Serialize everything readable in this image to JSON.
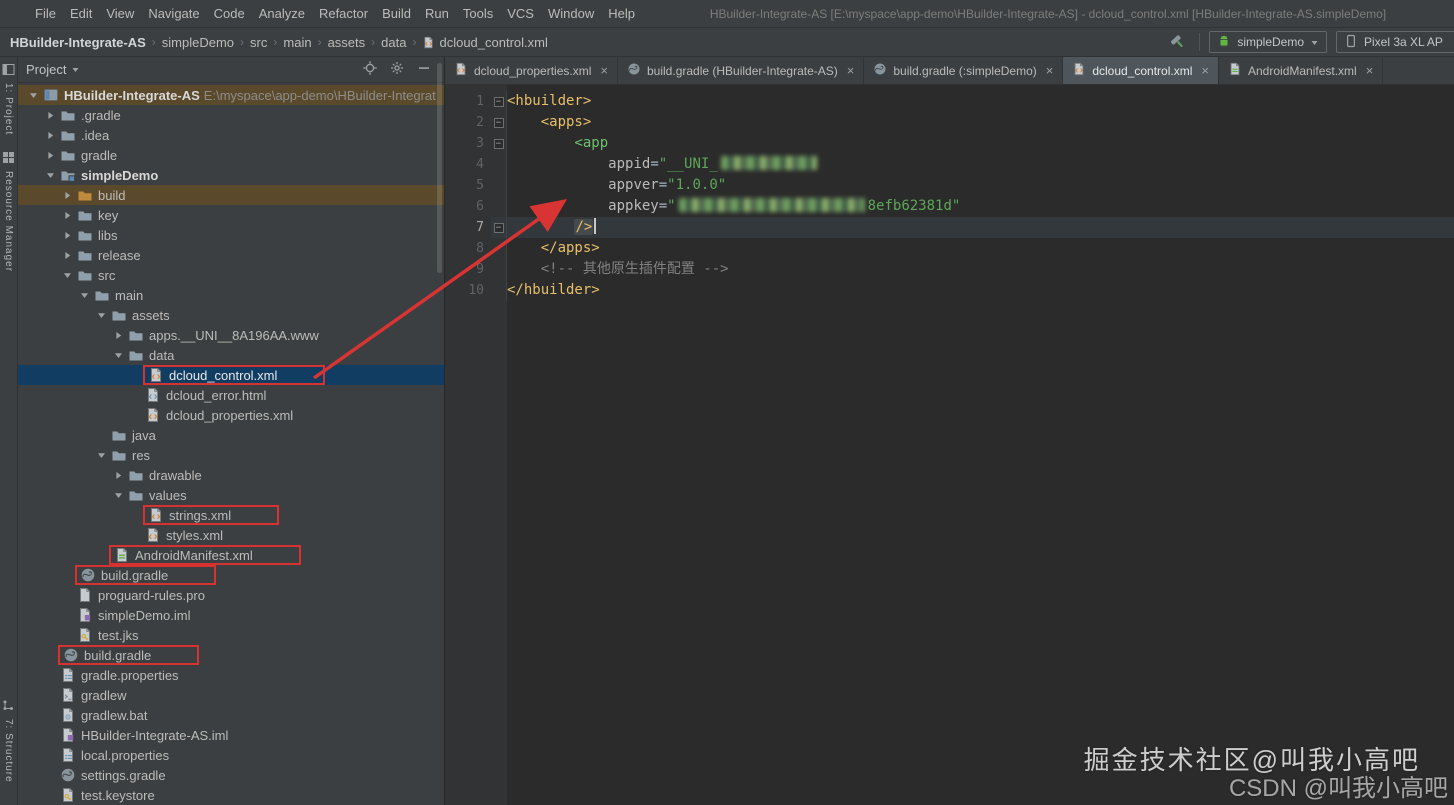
{
  "window": {
    "title": "HBuilder-Integrate-AS [E:\\myspace\\app-demo\\HBuilder-Integrate-AS] - dcloud_control.xml [HBuilder-Integrate-AS.simpleDemo]"
  },
  "menu": {
    "items": [
      "File",
      "Edit",
      "View",
      "Navigate",
      "Code",
      "Analyze",
      "Refactor",
      "Build",
      "Run",
      "Tools",
      "VCS",
      "Window",
      "Help"
    ]
  },
  "breadcrumb_bar": {
    "path": [
      "HBuilder-Integrate-AS",
      "simpleDemo",
      "src",
      "main",
      "assets",
      "data",
      "dcloud_control.xml"
    ]
  },
  "run_toolbar": {
    "config_label": "simpleDemo",
    "device_label": "Pixel 3a XL AP"
  },
  "left_stripe": {
    "top": [
      {
        "icon": "project-tool-icon",
        "label": "1: Project"
      },
      {
        "icon": "resource-manager-icon",
        "label": "Resource Manager"
      }
    ],
    "bottom": [
      {
        "icon": "structure-icon",
        "label": "7: Structure"
      }
    ]
  },
  "project_panel": {
    "title": "Project",
    "tree": [
      {
        "d": 0,
        "chevron": "open",
        "icon": "project",
        "label": "HBuilder-Integrate-AS",
        "extra": "E:\\myspace\\app-demo\\HBuilder-Integrat",
        "bold": true,
        "highlight": "brown"
      },
      {
        "d": 1,
        "chevron": "closed",
        "icon": "folder",
        "label": ".gradle"
      },
      {
        "d": 1,
        "chevron": "closed",
        "icon": "folder",
        "label": ".idea"
      },
      {
        "d": 1,
        "chevron": "closed",
        "icon": "folder",
        "label": "gradle"
      },
      {
        "d": 1,
        "chevron": "open",
        "icon": "module",
        "label": "simpleDemo",
        "bold": true
      },
      {
        "d": 2,
        "chevron": "closed",
        "icon": "folder-build",
        "label": "build",
        "highlight": "brown"
      },
      {
        "d": 2,
        "chevron": "closed",
        "icon": "folder",
        "label": "key"
      },
      {
        "d": 2,
        "chevron": "closed",
        "icon": "folder",
        "label": "libs"
      },
      {
        "d": 2,
        "chevron": "closed",
        "icon": "folder",
        "label": "release"
      },
      {
        "d": 2,
        "chevron": "open",
        "icon": "folder",
        "label": "src"
      },
      {
        "d": 3,
        "chevron": "open",
        "icon": "folder",
        "label": "main"
      },
      {
        "d": 4,
        "chevron": "open",
        "icon": "folder",
        "label": "assets"
      },
      {
        "d": 5,
        "chevron": "closed",
        "icon": "folder",
        "label": "apps.__UNI__8A196AA.www"
      },
      {
        "d": 5,
        "chevron": "open",
        "icon": "folder",
        "label": "data"
      },
      {
        "d": 6,
        "icon": "xml",
        "label": "dcloud_control.xml",
        "selected": true,
        "redbox": true
      },
      {
        "d": 6,
        "icon": "html",
        "label": "dcloud_error.html"
      },
      {
        "d": 6,
        "icon": "xml",
        "label": "dcloud_properties.xml"
      },
      {
        "d": 4,
        "icon": "folder",
        "label": "java"
      },
      {
        "d": 4,
        "chevron": "open",
        "icon": "folder",
        "label": "res"
      },
      {
        "d": 5,
        "chevron": "closed",
        "icon": "folder",
        "label": "drawable"
      },
      {
        "d": 5,
        "chevron": "open",
        "icon": "folder",
        "label": "values"
      },
      {
        "d": 6,
        "icon": "xml",
        "label": "strings.xml",
        "redbox": true
      },
      {
        "d": 6,
        "icon": "xml",
        "label": "styles.xml"
      },
      {
        "d": 4,
        "icon": "manifest",
        "label": "AndroidManifest.xml",
        "redbox": true
      },
      {
        "d": 2,
        "icon": "gradle",
        "label": "build.gradle",
        "redbox": true
      },
      {
        "d": 2,
        "icon": "file",
        "label": "proguard-rules.pro"
      },
      {
        "d": 2,
        "icon": "iml",
        "label": "simpleDemo.iml"
      },
      {
        "d": 2,
        "icon": "keystore",
        "label": "test.jks"
      },
      {
        "d": 1,
        "icon": "gradle",
        "label": "build.gradle",
        "redbox": true
      },
      {
        "d": 1,
        "icon": "properties",
        "label": "gradle.properties"
      },
      {
        "d": 1,
        "icon": "script",
        "label": "gradlew"
      },
      {
        "d": 1,
        "icon": "bat",
        "label": "gradlew.bat"
      },
      {
        "d": 1,
        "icon": "iml",
        "label": "HBuilder-Integrate-AS.iml"
      },
      {
        "d": 1,
        "icon": "properties",
        "label": "local.properties"
      },
      {
        "d": 1,
        "icon": "gradle",
        "label": "settings.gradle"
      },
      {
        "d": 1,
        "icon": "keystore",
        "label": "test.keystore"
      }
    ]
  },
  "editor": {
    "tabs": [
      {
        "icon": "xml",
        "label": "dcloud_properties.xml",
        "active": false
      },
      {
        "icon": "gradle",
        "label": "build.gradle (HBuilder-Integrate-AS)",
        "active": false
      },
      {
        "icon": "gradle",
        "label": "build.gradle (:simpleDemo)",
        "active": false
      },
      {
        "icon": "xml",
        "label": "dcloud_control.xml",
        "active": true
      },
      {
        "icon": "manifest",
        "label": "AndroidManifest.xml",
        "active": false
      }
    ],
    "code": [
      {
        "n": 1,
        "fold": true,
        "segs": [
          [
            "tag",
            "<hbuilder>"
          ]
        ]
      },
      {
        "n": 2,
        "fold": true,
        "segs": [
          [
            "sp",
            4
          ],
          [
            "tag",
            "<apps>"
          ]
        ]
      },
      {
        "n": 3,
        "fold": true,
        "segs": [
          [
            "sp",
            8
          ],
          [
            "tagopen",
            "<app"
          ]
        ]
      },
      {
        "n": 4,
        "segs": [
          [
            "sp",
            12
          ],
          [
            "attr",
            "appid"
          ],
          [
            "punct",
            "="
          ],
          [
            "str",
            "\"__UNI_"
          ],
          [
            "blur",
            96
          ]
        ]
      },
      {
        "n": 5,
        "segs": [
          [
            "sp",
            12
          ],
          [
            "attr",
            "appver"
          ],
          [
            "punct",
            "="
          ],
          [
            "str",
            "\"1.0.0\""
          ]
        ]
      },
      {
        "n": 6,
        "segs": [
          [
            "sp",
            12
          ],
          [
            "attr",
            "appkey"
          ],
          [
            "punct",
            "="
          ],
          [
            "str",
            "\""
          ],
          [
            "blur",
            186
          ],
          [
            "str",
            "8efb62381d\""
          ]
        ]
      },
      {
        "n": 7,
        "active": true,
        "fold": true,
        "segs": [
          [
            "sp",
            8
          ],
          [
            "tagcur",
            "/>"
          ],
          [
            "cursor",
            0
          ]
        ]
      },
      {
        "n": 8,
        "segs": [
          [
            "sp",
            4
          ],
          [
            "tag",
            "</apps>"
          ]
        ]
      },
      {
        "n": 9,
        "segs": [
          [
            "sp",
            4
          ],
          [
            "comment",
            "<!-- 其他原生插件配置 -->"
          ]
        ]
      },
      {
        "n": 10,
        "segs": [
          [
            "tag",
            "</hbuilder>"
          ]
        ]
      }
    ]
  },
  "colors": {
    "selection_blue": "#123d63",
    "highlight_brown": "#5a4a2b",
    "annotation_red": "#d73232",
    "tag_gold": "#e8bf6a",
    "string_green": "#5da758"
  },
  "watermarks": {
    "line1": "掘金技术社区@叫我小高吧",
    "line2": "CSDN @叫我小高吧"
  }
}
